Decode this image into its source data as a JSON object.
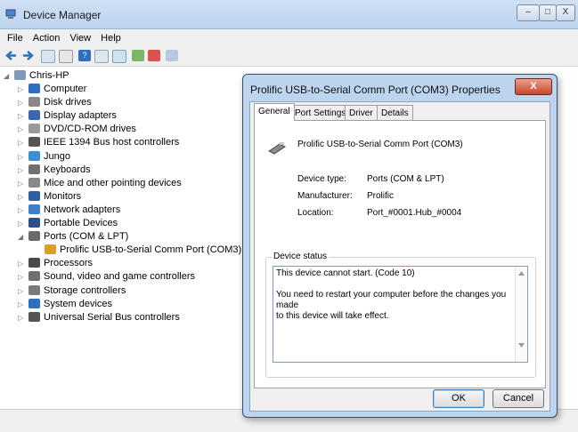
{
  "window": {
    "title": "Device Manager"
  },
  "menu": [
    "File",
    "Action",
    "View",
    "Help"
  ],
  "tree": {
    "root": "Chris-HP",
    "items": [
      {
        "label": "Computer",
        "icon": "computer-icon",
        "color": "#2e6fbf",
        "expander": "▷"
      },
      {
        "label": "Disk drives",
        "icon": "disk-drive-icon",
        "color": "#8a8a8a",
        "expander": "▷"
      },
      {
        "label": "Display adapters",
        "icon": "display-adapter-icon",
        "color": "#3a66b5",
        "expander": "▷"
      },
      {
        "label": "DVD/CD-ROM drives",
        "icon": "dvd-drive-icon",
        "color": "#9a9a9a",
        "expander": "▷"
      },
      {
        "label": "IEEE 1394 Bus host controllers",
        "icon": "ieee1394-icon",
        "color": "#555555",
        "expander": "▷"
      },
      {
        "label": "Jungo",
        "icon": "jungo-icon",
        "color": "#3b8ed8",
        "expander": "▷"
      },
      {
        "label": "Keyboards",
        "icon": "keyboard-icon",
        "color": "#707070",
        "expander": "▷"
      },
      {
        "label": "Mice and other pointing devices",
        "icon": "mouse-icon",
        "color": "#8a8a8a",
        "expander": "▷"
      },
      {
        "label": "Monitors",
        "icon": "monitor-icon",
        "color": "#2f5fa8",
        "expander": "▷"
      },
      {
        "label": "Network adapters",
        "icon": "network-adapter-icon",
        "color": "#3f7fc9",
        "expander": "▷"
      },
      {
        "label": "Portable Devices",
        "icon": "portable-device-icon",
        "color": "#2b4f8a",
        "expander": "▷"
      },
      {
        "label": "Ports (COM & LPT)",
        "icon": "port-icon",
        "color": "#6a6a6a",
        "expander": "◢"
      },
      {
        "label": "Prolific USB-to-Serial Comm Port (COM3)",
        "icon": "warning-port-icon",
        "color": "#d9a21a",
        "expander": "",
        "child": true
      },
      {
        "label": "Processors",
        "icon": "processor-icon",
        "color": "#4a4a4a",
        "expander": "▷"
      },
      {
        "label": "Sound, video and game controllers",
        "icon": "sound-icon",
        "color": "#6f6f6f",
        "expander": "▷"
      },
      {
        "label": "Storage controllers",
        "icon": "storage-controller-icon",
        "color": "#7a7a7a",
        "expander": "▷"
      },
      {
        "label": "System devices",
        "icon": "system-device-icon",
        "color": "#2e6fbf",
        "expander": "▷"
      },
      {
        "label": "Universal Serial Bus controllers",
        "icon": "usb-icon",
        "color": "#555555",
        "expander": "▷"
      }
    ]
  },
  "dialog": {
    "title": "Prolific USB-to-Serial Comm Port (COM3) Properties",
    "close": "X",
    "tabs": [
      "General",
      "Port Settings",
      "Driver",
      "Details"
    ],
    "device_name": "Prolific USB-to-Serial Comm Port (COM3)",
    "device_type_label": "Device type:",
    "device_type_value": "Ports (COM & LPT)",
    "manufacturer_label": "Manufacturer:",
    "manufacturer_value": "Prolific",
    "location_label": "Location:",
    "location_value": "Port_#0001.Hub_#0004",
    "status_group_title": "Device status",
    "status_text": "This device cannot start. (Code 10)\n\nYou need to restart your computer before the changes you made\nto this device will take effect.",
    "ok": "OK",
    "cancel": "Cancel"
  }
}
